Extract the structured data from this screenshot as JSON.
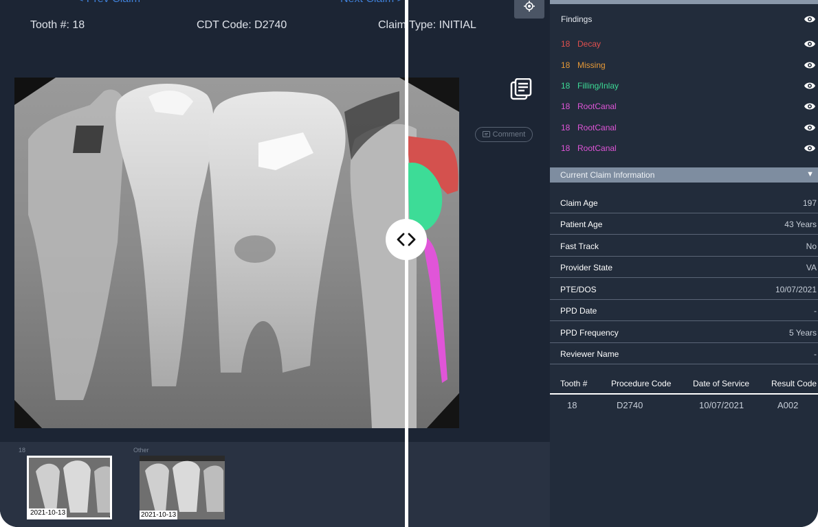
{
  "nav": {
    "prev_label": "< Prev Claim",
    "next_label": "Next Claim >"
  },
  "header": {
    "tooth": "Tooth #: 18",
    "cdt": "CDT Code: D2740",
    "claim_type": "Claim Type: INITIAL"
  },
  "actions": {
    "comment_label": "Comment"
  },
  "thumbnails": {
    "groups": [
      {
        "label": "18",
        "date": "2021-10-13"
      },
      {
        "label": "Other",
        "date": "2021-10-13"
      }
    ]
  },
  "findings": {
    "title": "Findings",
    "items": [
      {
        "tooth": "18",
        "label": "Decay",
        "color": "#e2504e"
      },
      {
        "tooth": "18",
        "label": "Missing",
        "color": "#e89a37"
      },
      {
        "tooth": "18",
        "label": "Filling/Inlay",
        "color": "#3ddc97"
      },
      {
        "tooth": "18",
        "label": "RootCanal",
        "color": "#e055d8"
      },
      {
        "tooth": "18",
        "label": "RootCanal",
        "color": "#e055d8"
      },
      {
        "tooth": "18",
        "label": "RootCanal",
        "color": "#e055d8"
      }
    ]
  },
  "claim_info": {
    "title": "Current Claim Information",
    "rows": [
      {
        "label": "Claim Age",
        "value": "197"
      },
      {
        "label": "Patient Age",
        "value": "43 Years"
      },
      {
        "label": "Fast Track",
        "value": "No"
      },
      {
        "label": "Provider State",
        "value": "VA"
      },
      {
        "label": "PTE/DOS",
        "value": "10/07/2021"
      },
      {
        "label": "PPD Date",
        "value": "-"
      },
      {
        "label": "PPD Frequency",
        "value": "5 Years"
      },
      {
        "label": "Reviewer Name",
        "value": "-"
      }
    ]
  },
  "history_table": {
    "headers": [
      "Tooth #",
      "Procedure Code",
      "Date of Service",
      "Result Code"
    ],
    "rows": [
      [
        "18",
        "D2740",
        "10/07/2021",
        "A002"
      ]
    ]
  },
  "colors": {
    "accent": "#3f7fd6",
    "panel": "#222c3b",
    "section": "#7e8da0"
  }
}
